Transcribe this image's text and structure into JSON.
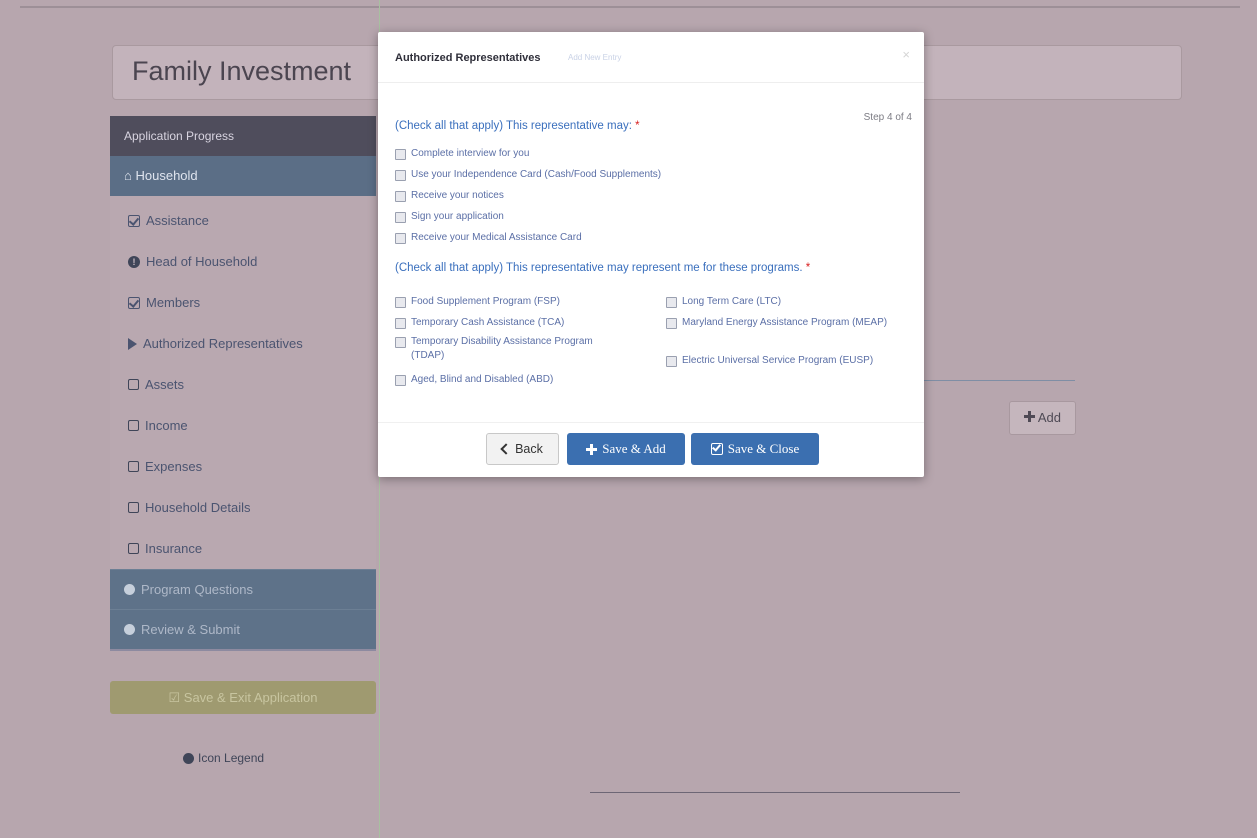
{
  "header": {
    "app_title": "Family Investment"
  },
  "sidebar": {
    "progress_header": "Application Progress",
    "household_label": "Household",
    "items": [
      {
        "label": "Assistance",
        "icon": "check-square-icon"
      },
      {
        "label": "Head of Household",
        "icon": "exclamation-circle-icon"
      },
      {
        "label": "Members",
        "icon": "check-square-icon"
      },
      {
        "label": "Authorized Representatives",
        "icon": "play-icon"
      },
      {
        "label": "Assets",
        "icon": "empty-square-icon"
      },
      {
        "label": "Income",
        "icon": "empty-square-icon"
      },
      {
        "label": "Expenses",
        "icon": "empty-square-icon"
      },
      {
        "label": "Household Details",
        "icon": "empty-square-icon"
      },
      {
        "label": "Insurance",
        "icon": "empty-square-icon"
      }
    ],
    "program_questions": "Program Questions",
    "review_submit": "Review & Submit",
    "save_exit": "Save & Exit Application",
    "icon_legend": "Icon Legend"
  },
  "background": {
    "add_label": "Add"
  },
  "modal": {
    "title": "Authorized Representatives",
    "subtitle": "Add New Entry",
    "close": "×",
    "step": "Step 4 of 4",
    "question1": "(Check all that apply) This representative may:",
    "question1_options": [
      "Complete interview for you",
      "Use your Independence Card (Cash/Food Supplements)",
      "Receive your notices",
      "Sign your application",
      "Receive your Medical Assistance Card"
    ],
    "question2": "(Check all that apply) This representative may represent me for these programs.",
    "question2_left": [
      "Food Supplement Program (FSP)",
      "Temporary Cash Assistance (TCA)",
      "Temporary Disability Assistance Program (TDAP)",
      "Aged, Blind and Disabled (ABD)"
    ],
    "question2_right": [
      "Long Term Care (LTC)",
      "Maryland Energy Assistance Program (MEAP)",
      "Electric Universal Service Program (EUSP)"
    ],
    "required_mark": "*",
    "buttons": {
      "back": "Back",
      "save_add": "Save & Add",
      "save_close": "Save & Close"
    }
  },
  "colors": {
    "modal_accent": "#3b6fb0",
    "link_blue": "#3a6fbd",
    "required": "#d82020",
    "sidebar_active": "#5b6e86"
  }
}
